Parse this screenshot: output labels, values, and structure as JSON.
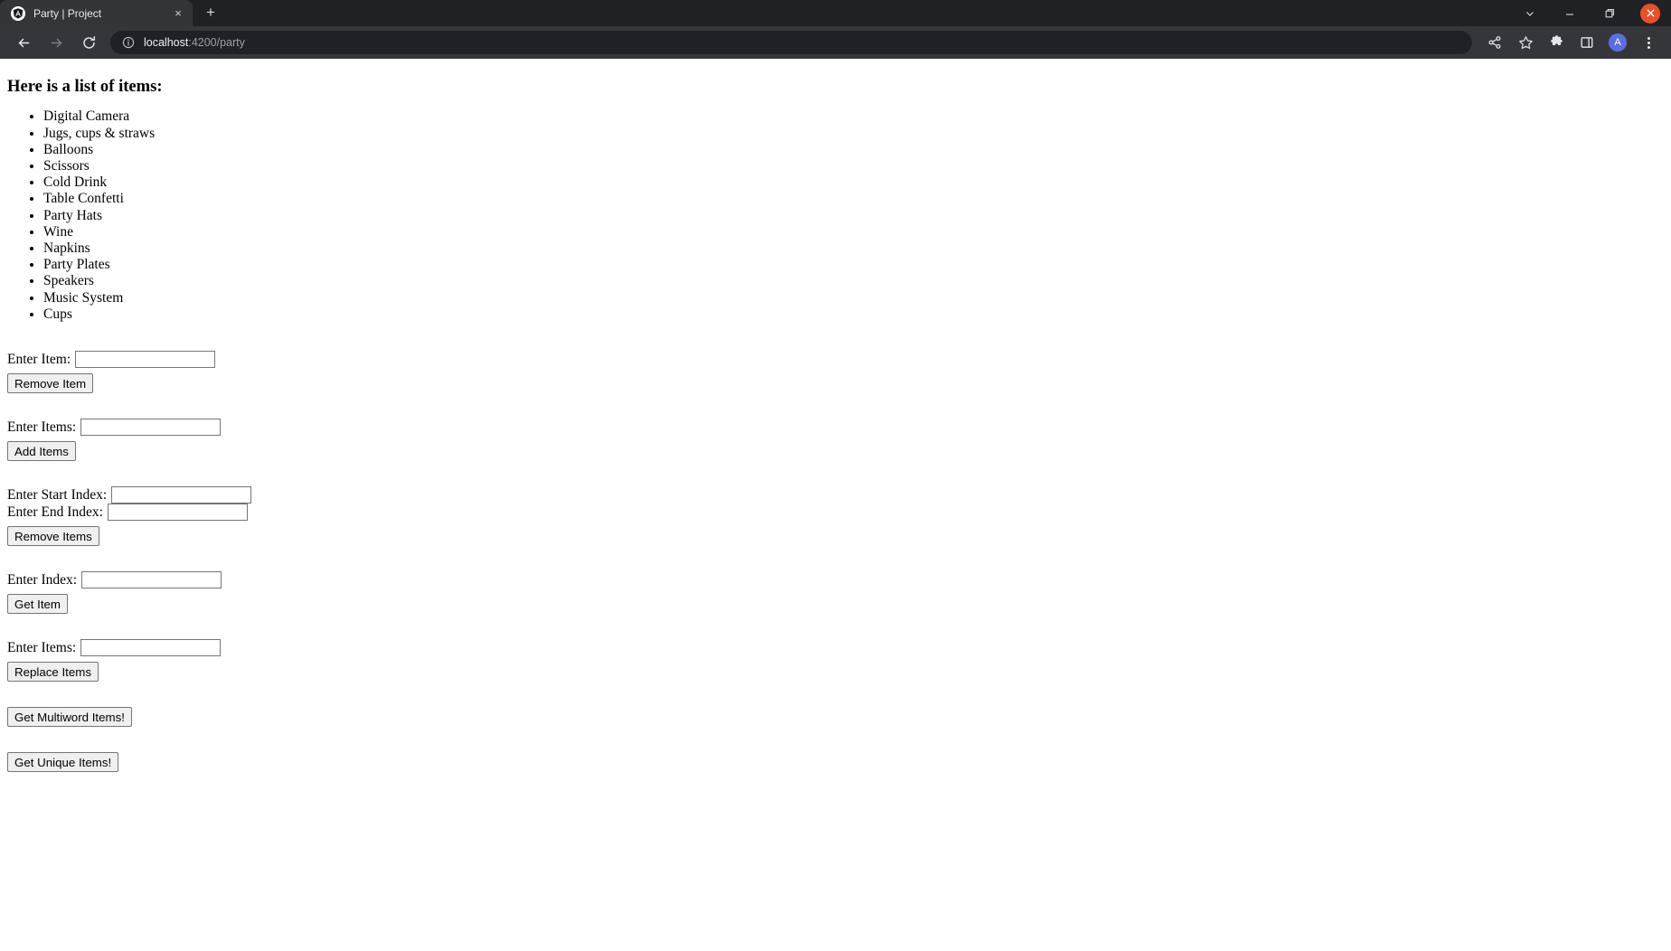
{
  "browser": {
    "tab": {
      "title": "Party | Project",
      "favicon_name": "angular-favicon",
      "close_label": "×"
    },
    "new_tab_label": "+",
    "window_controls": {
      "tab_search_label": "tab-search",
      "minimize_label": "minimize",
      "maximize_label": "maximize",
      "close_label": "close"
    },
    "toolbar": {
      "back_label": "Back",
      "forward_label": "Forward",
      "reload_label": "Reload",
      "url_host": "localhost",
      "url_rest": ":4200/party",
      "url_full": "localhost:4200/party",
      "site_info_label": "View site information",
      "share_label": "Share this page",
      "bookmark_label": "Bookmark this tab",
      "extensions_label": "Extensions",
      "side_panel_label": "Side panel",
      "profile_initial": "A",
      "menu_label": "Customize and control Google Chrome"
    },
    "colors": {
      "tabstrip_bg": "#202124",
      "active_tab_bg": "#323639",
      "toolbar_bg": "#35363a",
      "omnibox_bg": "#202124",
      "close_button": "#e8502a",
      "avatar": "#5b6ee1",
      "page_bg": "#ffffff"
    }
  },
  "page": {
    "heading": "Here is a list of items:",
    "items": [
      "Digital Camera",
      "Jugs, cups & straws",
      "Balloons",
      "Scissors",
      "Cold Drink",
      "Table Confetti",
      "Party Hats",
      "Wine",
      "Napkins",
      "Party Plates",
      "Speakers",
      "Music System",
      "Cups"
    ],
    "forms": {
      "remove_item": {
        "label": "Enter Item:",
        "input_value": "",
        "input_placeholder": "",
        "button": "Remove Item"
      },
      "add_items": {
        "label": "Enter Items:",
        "input_value": "",
        "input_placeholder": "",
        "button": "Add Items"
      },
      "remove_range": {
        "start_label": "Enter Start Index:",
        "start_value": "",
        "end_label": "Enter End Index:",
        "end_value": "",
        "button": "Remove Items"
      },
      "get_item": {
        "label": "Enter Index:",
        "input_value": "",
        "input_placeholder": "",
        "button": "Get Item"
      },
      "replace_items": {
        "label": "Enter Items:",
        "input_value": "",
        "input_placeholder": "",
        "button": "Replace Items"
      },
      "multiword_button": "Get Multiword Items!",
      "unique_button": "Get Unique Items!"
    }
  }
}
